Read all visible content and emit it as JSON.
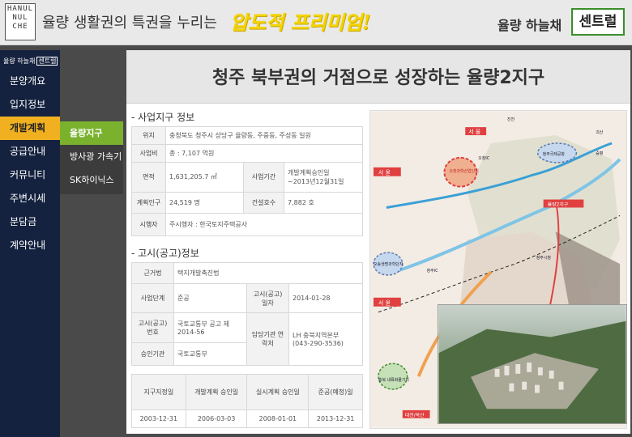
{
  "header": {
    "logo_lines": [
      "HANUL",
      "NUL",
      "CHE"
    ],
    "tagline": "율량 생활권의 특권을 누리는",
    "tagline_accent": "압도적 프리미엄!",
    "brand": "율량 하늘채",
    "brand_box": "센트럴"
  },
  "sidebar": {
    "brand": "율량 하늘채",
    "brand_box": "센트럴",
    "items": [
      {
        "label": "분양개요"
      },
      {
        "label": "입지정보"
      },
      {
        "label": "개발계획"
      },
      {
        "label": "공급안내"
      },
      {
        "label": "커뮤니티"
      },
      {
        "label": "주변시세"
      },
      {
        "label": "분담금"
      },
      {
        "label": "계약안내"
      }
    ],
    "active_index": 2
  },
  "submenu": {
    "items": [
      {
        "label": "율량지구"
      },
      {
        "label": "방사광 가속기"
      },
      {
        "label": "SK하이닉스"
      }
    ],
    "active_index": 0
  },
  "main": {
    "title": "청주 북부권의 거점으로 성장하는 율량2지구",
    "section1": {
      "title": "- 사업지구 정보",
      "rows": {
        "location_label": "위치",
        "location_value": "충청북도 청주시 상당구 율량동, 주중동, 주성동 일원",
        "cost_label": "사업비",
        "cost_value": "총 : 7,107 억원",
        "area_label": "면적",
        "area_value": "1,631,205.7 ㎡",
        "period_label": "사업기간",
        "period_value_1": "개발계획승인일",
        "period_value_2": "~2013년12월31일",
        "pop_label": "계획인구",
        "pop_value": "24,519 명",
        "houses_label": "건설호수",
        "houses_value": "7,882 호",
        "operator_label": "시행자",
        "operator_value": "주시행자 : 한국토지주택공사"
      }
    },
    "section2": {
      "title": "- 고시(공고)정보",
      "rows": {
        "law_label": "근거법",
        "law_value": "택지개발촉진법",
        "stage_label": "사업단계",
        "stage_value": "준공",
        "notice_date_label": "고시(공고) 일자",
        "notice_date_value": "2014-01-28",
        "notice_no_label": "고시(공고) 번호",
        "notice_no_value": "국토교통부 공고 제2014-56",
        "contact_label": "담당기관 연락처",
        "contact_value_1": "LH 충북지역본부",
        "contact_value_2": "(043-290-3536)",
        "approval_label": "승인기관",
        "approval_value": "국토교통부"
      }
    },
    "timeline": {
      "headers": [
        "지구지정일",
        "개발계획 승인일",
        "실시계획 승인일",
        "준공(예정)일"
      ],
      "values": [
        "2003-12-31",
        "2006-03-03",
        "2008-01-01",
        "2013-12-31"
      ]
    },
    "map_labels": {
      "seoul_top": "서 울",
      "seoul_mid": "서 울",
      "seoul_bottom": "서 울",
      "osong": "오창과학산업단지",
      "osong_life": "오송생명과학단지",
      "cheongju_airport": "청주국제공항",
      "yulryang": "율량2지구",
      "jeungpyeong": "증평",
      "jincheon": "진천",
      "daejeon": "대전/옥산",
      "cheongju_ic": "청주IC",
      "city_hall": "청주시청",
      "ochang_ic": "오창IC",
      "cheongwon": "충북 내륙화물기지",
      "goesan": "괴산"
    },
    "colors": {
      "sidebar_bg": "#15223f",
      "active_menu": "#f0b020",
      "active_sub": "#7ab22e",
      "brand_green": "#3a8f2a",
      "accent_yellow": "#f5d400"
    }
  }
}
